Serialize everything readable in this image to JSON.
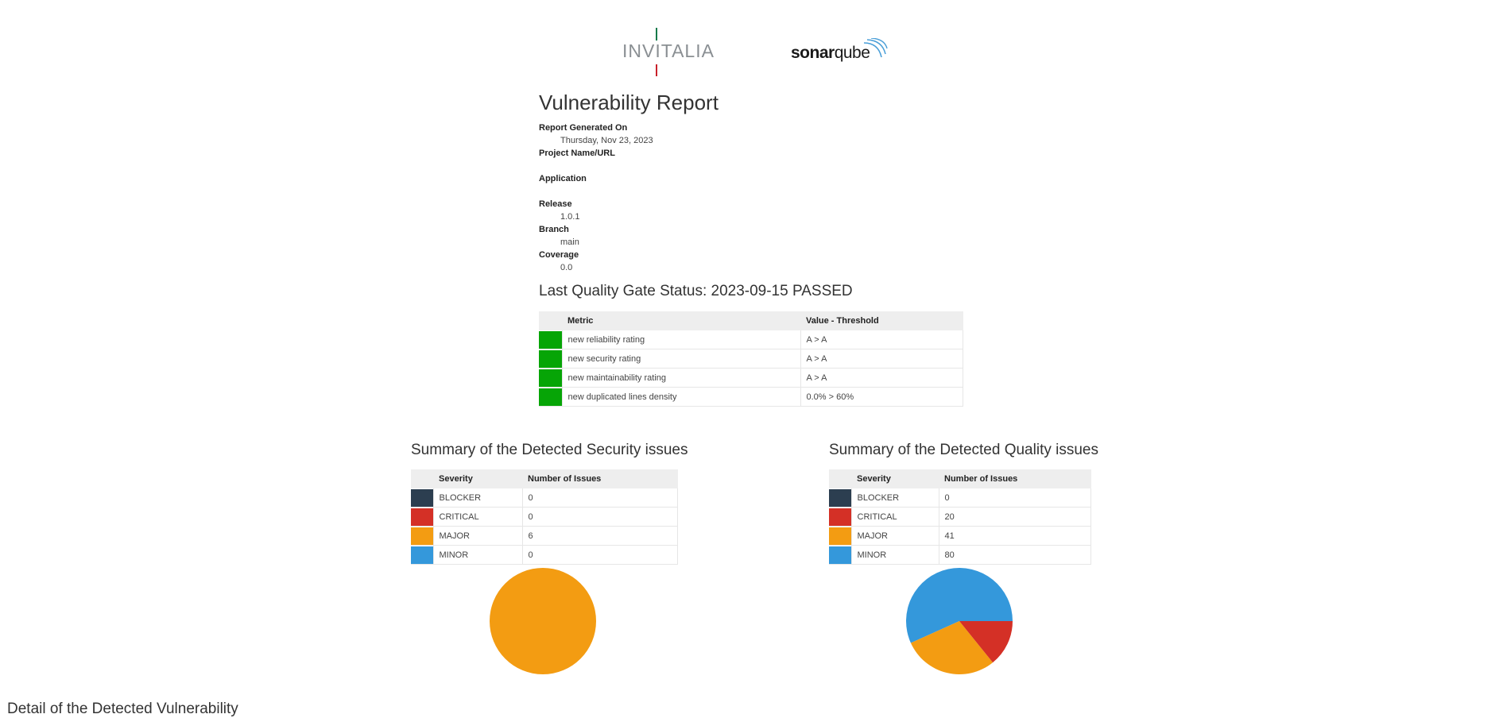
{
  "logos": {
    "invitalia": "INVITALIA",
    "sonar_bold": "sonar",
    "sonar_regular": "qube"
  },
  "report": {
    "title": "Vulnerability Report",
    "fields": [
      {
        "label": "Report Generated On",
        "value": "Thursday, Nov 23, 2023"
      },
      {
        "label": "Project Name/URL",
        "value": ""
      },
      {
        "label": "Application",
        "value": ""
      },
      {
        "label": "Release",
        "value": "1.0.1"
      },
      {
        "label": "Branch",
        "value": "main"
      },
      {
        "label": "Coverage",
        "value": "0.0"
      }
    ]
  },
  "quality_gate": {
    "title": "Last Quality Gate Status: 2023-09-15 PASSED",
    "headers": [
      "Metric",
      "Value - Threshold"
    ],
    "pass_color": "#06a506",
    "rows": [
      {
        "metric": "new reliability rating",
        "value": "A > A"
      },
      {
        "metric": "new security rating",
        "value": "A > A"
      },
      {
        "metric": "new maintainability rating",
        "value": "A > A"
      },
      {
        "metric": "new duplicated lines density",
        "value": "0.0% > 60%"
      }
    ]
  },
  "severity_colors": {
    "BLOCKER": "#2c3e50",
    "CRITICAL": "#d43026",
    "MAJOR": "#f39c12",
    "MINOR": "#3498db"
  },
  "security": {
    "title": "Summary of the Detected Security issues",
    "headers": [
      "Severity",
      "Number of Issues"
    ],
    "rows": [
      {
        "severity": "BLOCKER",
        "count": "0"
      },
      {
        "severity": "CRITICAL",
        "count": "0"
      },
      {
        "severity": "MAJOR",
        "count": "6"
      },
      {
        "severity": "MINOR",
        "count": "0"
      }
    ]
  },
  "quality": {
    "title": "Summary of the Detected Quality issues",
    "headers": [
      "Severity",
      "Number of Issues"
    ],
    "rows": [
      {
        "severity": "BLOCKER",
        "count": "0"
      },
      {
        "severity": "CRITICAL",
        "count": "20"
      },
      {
        "severity": "MAJOR",
        "count": "41"
      },
      {
        "severity": "MINOR",
        "count": "80"
      }
    ]
  },
  "chart_data": [
    {
      "type": "pie",
      "categories": [
        "BLOCKER",
        "CRITICAL",
        "MAJOR",
        "MINOR"
      ],
      "values": [
        0,
        0,
        6,
        0
      ]
    },
    {
      "type": "pie",
      "categories": [
        "BLOCKER",
        "CRITICAL",
        "MAJOR",
        "MINOR"
      ],
      "values": [
        0,
        20,
        41,
        80
      ]
    }
  ],
  "detail": {
    "title": "Detail of the Detected Vulnerability"
  }
}
